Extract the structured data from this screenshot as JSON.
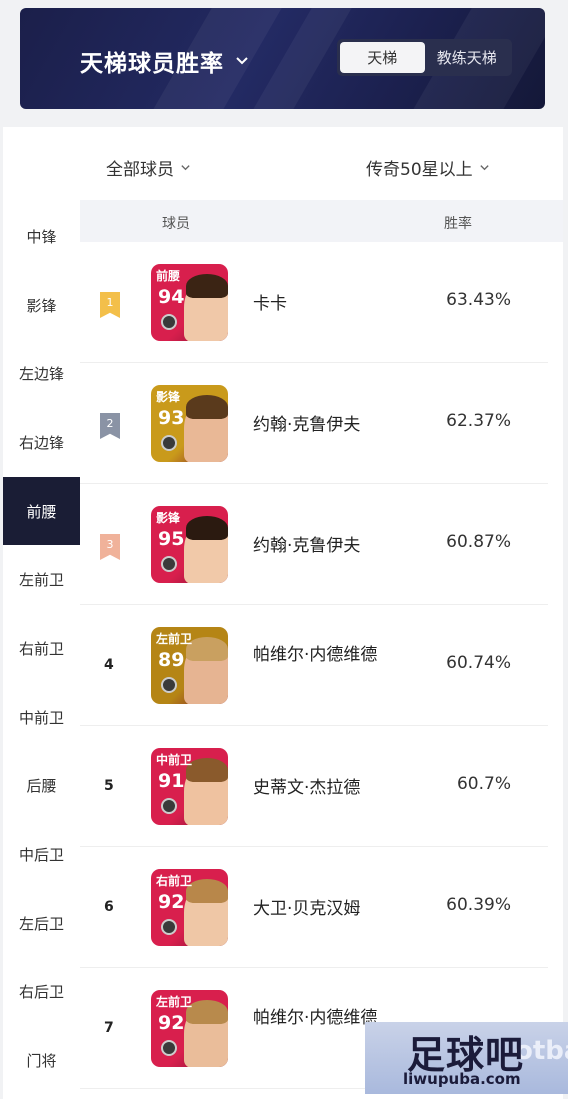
{
  "header": {
    "title": "天梯球员胜率",
    "tabs": [
      {
        "label": "天梯",
        "active": true
      },
      {
        "label": "教练天梯",
        "active": false
      }
    ]
  },
  "filters": {
    "players": "全部球员",
    "rarity": "传奇50星以上"
  },
  "table": {
    "col_player": "球员",
    "col_rate": "胜率"
  },
  "sidebar": {
    "items": [
      "中锋",
      "影锋",
      "左边锋",
      "右边锋",
      "前腰",
      "左前卫",
      "右前卫",
      "中前卫",
      "后腰",
      "中后卫",
      "左后卫",
      "右后卫",
      "门将"
    ],
    "active_index": 4
  },
  "rows": [
    {
      "rank": "1",
      "badge_color": "#f3bf4a",
      "position": "前腰",
      "rating": "94",
      "name": "卡卡",
      "rate": "63.43%",
      "card_color": "#d81f4d"
    },
    {
      "rank": "2",
      "badge_color": "#8a93a5",
      "position": "影锋",
      "rating": "93",
      "name": "约翰·克鲁伊夫",
      "rate": "62.37%",
      "card_color": "#c99a1b"
    },
    {
      "rank": "3",
      "badge_color": "#f0b29a",
      "position": "影锋",
      "rating": "95",
      "name": "约翰·克鲁伊夫",
      "rate": "60.87%",
      "card_color": "#d81f4d"
    },
    {
      "rank": "4",
      "badge_color": "",
      "position": "左前卫",
      "rating": "89",
      "name": "帕维尔·内德维德",
      "rate": "60.74%",
      "card_color": "#b58515"
    },
    {
      "rank": "5",
      "badge_color": "",
      "position": "中前卫",
      "rating": "91",
      "name": "史蒂文·杰拉德",
      "rate": "60.7%",
      "card_color": "#d81f4d"
    },
    {
      "rank": "6",
      "badge_color": "",
      "position": "右前卫",
      "rating": "92",
      "name": "大卫·贝克汉姆",
      "rate": "60.39%",
      "card_color": "#d81f4d"
    },
    {
      "rank": "7",
      "badge_color": "",
      "position": "左前卫",
      "rating": "92",
      "name": "帕维尔·内德维德",
      "rate": "",
      "card_color": "#d81f4d"
    }
  ],
  "watermark": {
    "main": "足球吧",
    "sub": "liwupuba.com",
    "side": "otba"
  }
}
